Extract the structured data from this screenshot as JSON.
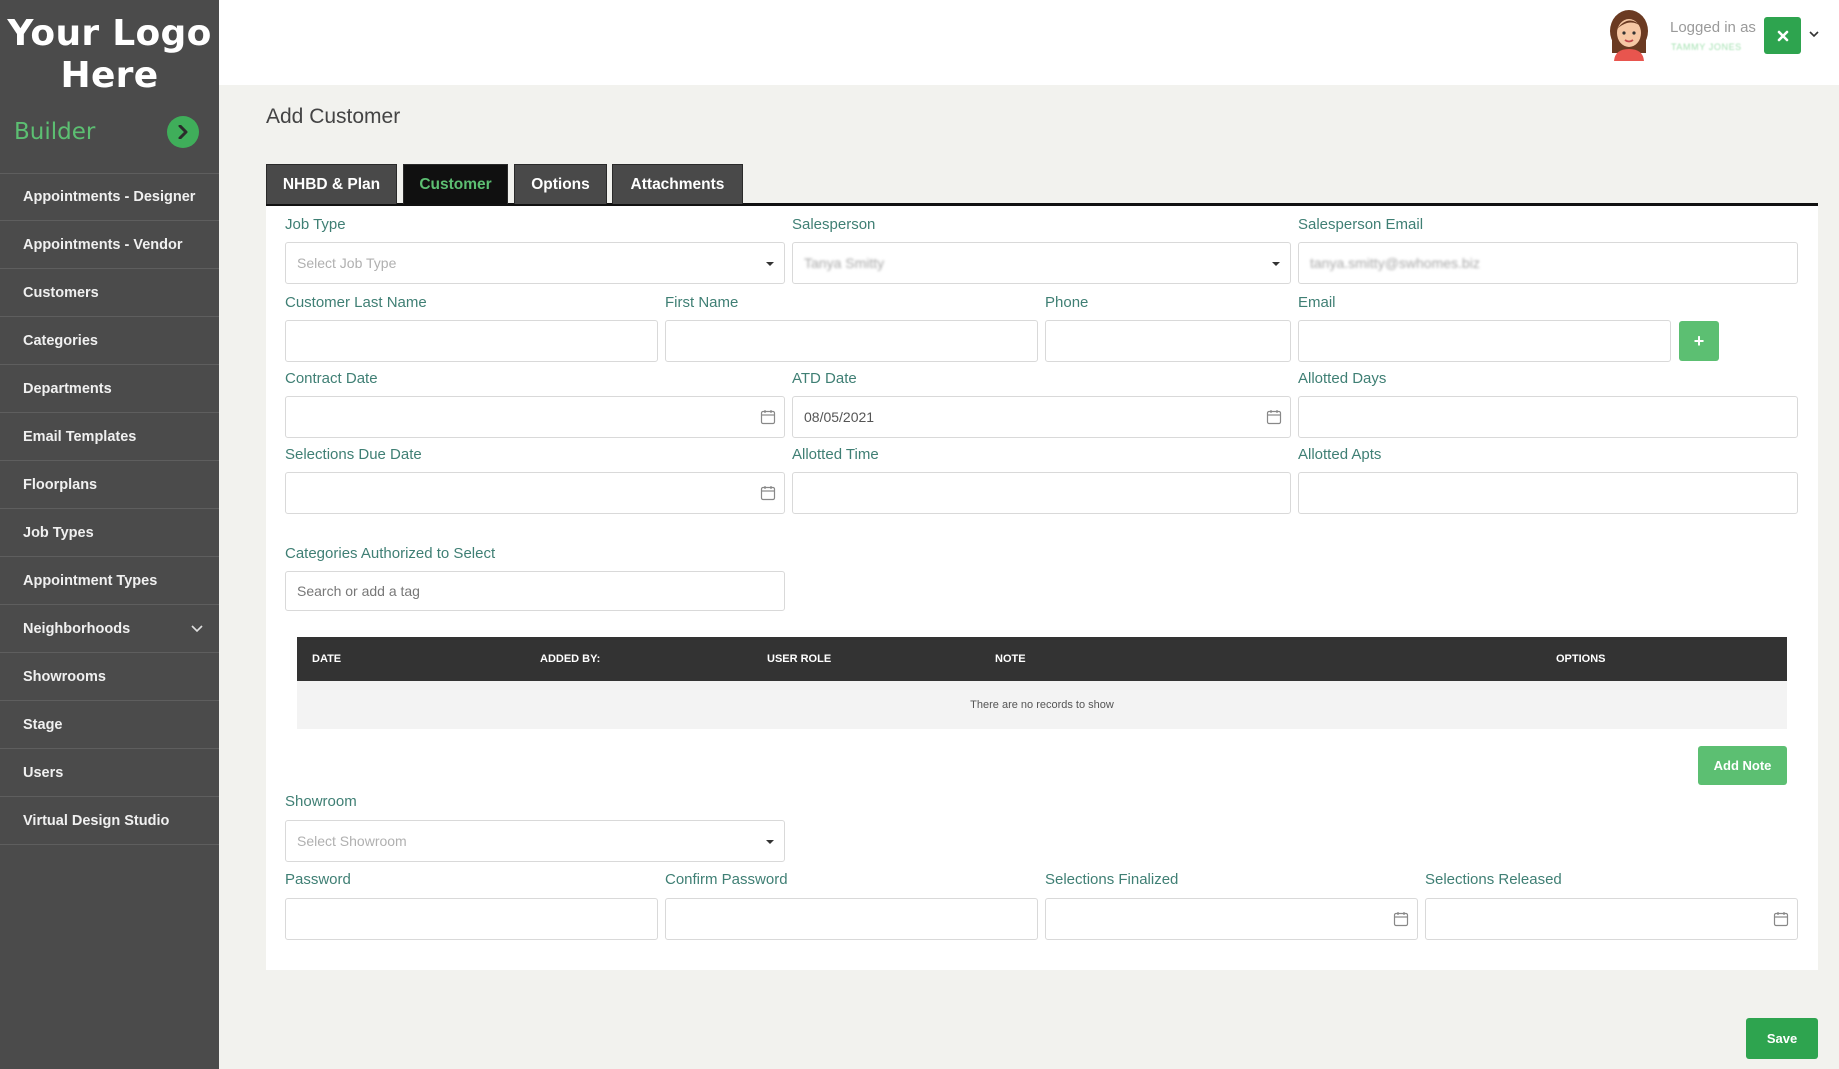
{
  "sidebar": {
    "logo_line1": "Your Logo",
    "logo_line2": "Here",
    "section_label": "Builder",
    "items": [
      {
        "label": "Appointments - Designer"
      },
      {
        "label": "Appointments - Vendor"
      },
      {
        "label": "Customers"
      },
      {
        "label": "Categories"
      },
      {
        "label": "Departments"
      },
      {
        "label": "Email Templates"
      },
      {
        "label": "Floorplans"
      },
      {
        "label": "Job Types"
      },
      {
        "label": "Appointment Types"
      },
      {
        "label": "Neighborhoods"
      },
      {
        "label": "Showrooms"
      },
      {
        "label": "Stage"
      },
      {
        "label": "Users"
      },
      {
        "label": "Virtual Design Studio"
      }
    ]
  },
  "header": {
    "logged_in_label": "Logged in as",
    "user_name": "TAMMY JONES"
  },
  "page": {
    "title": "Add Customer"
  },
  "tabs": [
    {
      "label": "NHBD & Plan"
    },
    {
      "label": "Customer"
    },
    {
      "label": "Options"
    },
    {
      "label": "Attachments"
    }
  ],
  "form": {
    "job_type": {
      "label": "Job Type",
      "placeholder": "Select Job Type"
    },
    "salesperson": {
      "label": "Salesperson",
      "value": "Tanya Smitty"
    },
    "salesperson_email": {
      "label": "Salesperson Email",
      "value": "tanya.smitty@swhomes.biz"
    },
    "customer_last_name": {
      "label": "Customer Last Name",
      "value": ""
    },
    "first_name": {
      "label": "First Name",
      "value": ""
    },
    "phone": {
      "label": "Phone",
      "value": ""
    },
    "email": {
      "label": "Email",
      "value": ""
    },
    "email_add_symbol": "+",
    "contract_date": {
      "label": "Contract Date",
      "value": ""
    },
    "atd_date": {
      "label": "ATD Date",
      "value": "08/05/2021"
    },
    "allotted_days": {
      "label": "Allotted Days",
      "value": ""
    },
    "selections_due_date": {
      "label": "Selections Due Date",
      "value": ""
    },
    "allotted_time": {
      "label": "Allotted Time",
      "value": ""
    },
    "allotted_apts": {
      "label": "Allotted Apts",
      "value": ""
    },
    "categories": {
      "label": "Categories Authorized to Select",
      "placeholder": "Search or add a tag"
    },
    "showroom": {
      "label": "Showroom",
      "placeholder": "Select Showroom"
    },
    "password": {
      "label": "Password",
      "value": ""
    },
    "confirm_password": {
      "label": "Confirm Password",
      "value": ""
    },
    "selections_finalized": {
      "label": "Selections Finalized",
      "value": ""
    },
    "selections_released": {
      "label": "Selections Released",
      "value": ""
    }
  },
  "notes_table": {
    "columns": [
      "DATE",
      "ADDED BY:",
      "USER ROLE",
      "NOTE",
      "OPTIONS"
    ],
    "empty_text": "There are no records to show"
  },
  "buttons": {
    "add_note": "Add Note",
    "save": "Save"
  },
  "colors": {
    "accent_green": "#5cbf72",
    "dark_green": "#2ea44f",
    "sidebar_bg": "#4b4b4b",
    "label_teal": "#3f7f74"
  }
}
